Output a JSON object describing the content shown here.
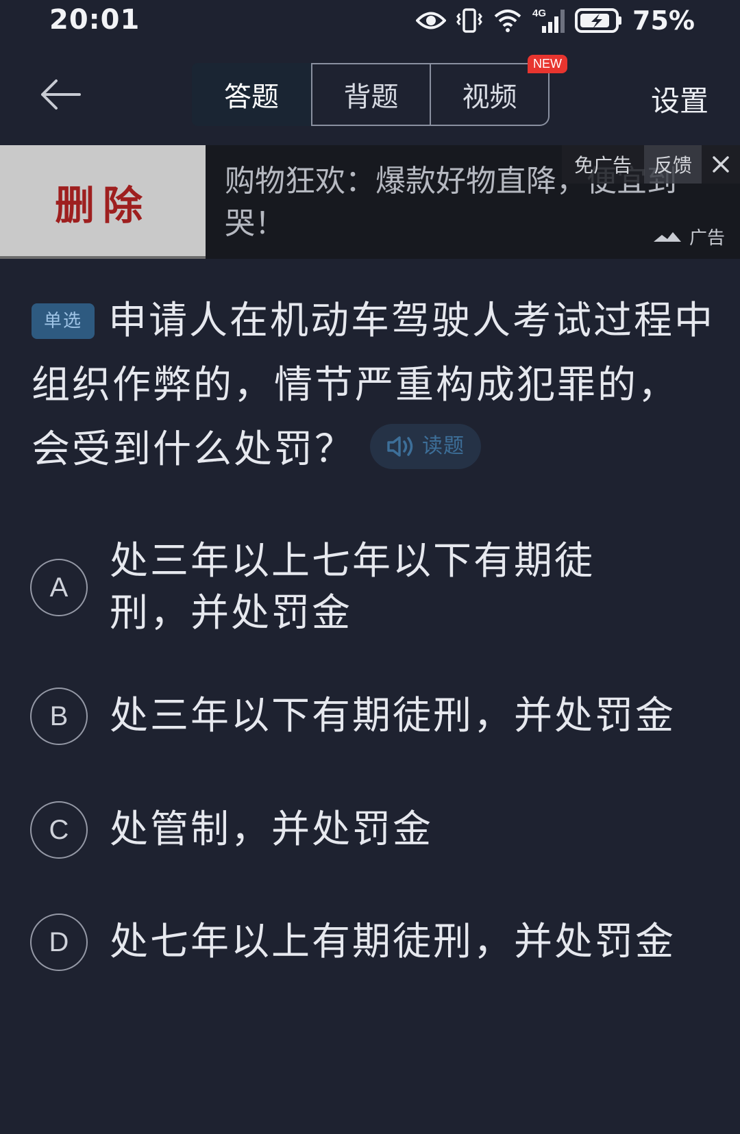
{
  "status_bar": {
    "time": "20:01",
    "network": "4G",
    "battery_percent": "75%",
    "icons": [
      "eye-icon",
      "vibrate-icon",
      "wifi-icon",
      "signal-4g-icon",
      "battery-charging-icon"
    ]
  },
  "nav": {
    "back_icon": "arrow-left-icon",
    "tabs": [
      {
        "label": "答题",
        "active": true
      },
      {
        "label": "背题",
        "active": false
      },
      {
        "label": "视频",
        "active": false,
        "badge": "NEW"
      }
    ],
    "settings_label": "设置"
  },
  "ad": {
    "image_text": "删除",
    "text": "购物狂欢：爆款好物直降，便宜到哭！",
    "no_ad_label": "免广告",
    "feedback_label": "反馈",
    "close_icon": "close-icon",
    "ad_label": "广告"
  },
  "question": {
    "type_badge": "单选",
    "text": "申请人在机动车驾驶人考试过程中组织作弊的，情节严重构成犯罪的，会受到什么处罚？",
    "read_label": "读题"
  },
  "options": [
    {
      "letter": "A",
      "text": "处三年以上七年以下有期徒刑，并处罚金"
    },
    {
      "letter": "B",
      "text": "处三年以下有期徒刑，并处罚金"
    },
    {
      "letter": "C",
      "text": "处管制，并处罚金"
    },
    {
      "letter": "D",
      "text": "处七年以上有期徒刑，并处罚金"
    }
  ]
}
